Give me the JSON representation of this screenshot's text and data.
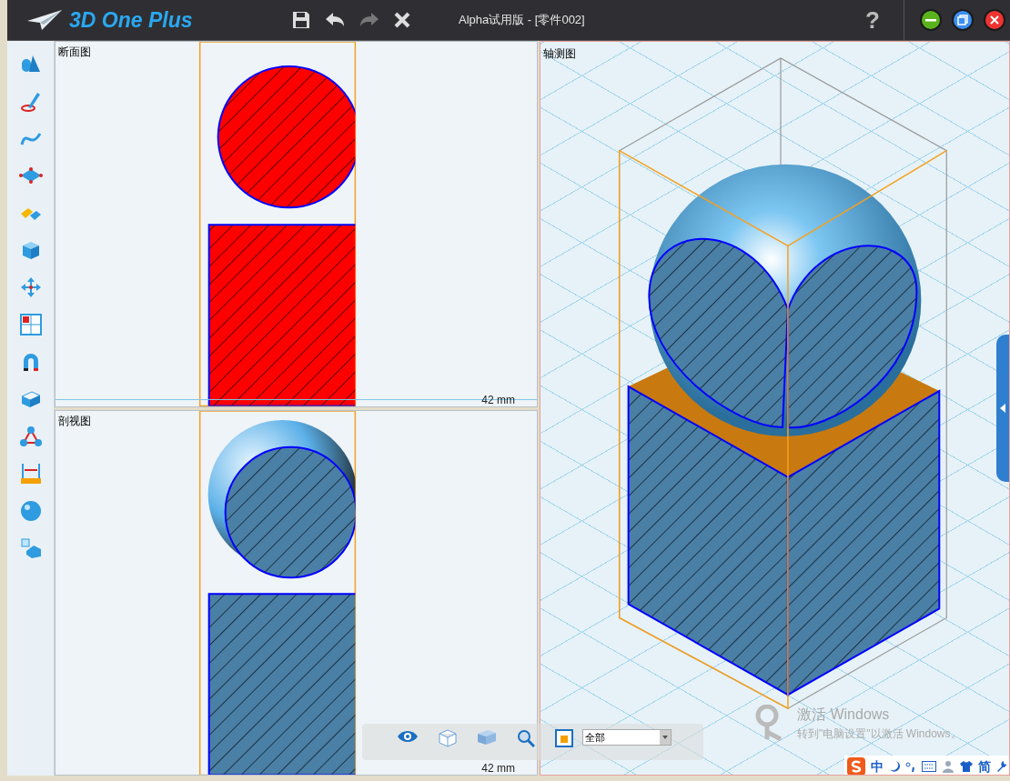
{
  "window": {
    "logo": "3D One Plus",
    "title": "Alpha试用版 - [零件002]",
    "help": "?"
  },
  "views": [
    {
      "title": "断面图",
      "dimension": "42 mm"
    },
    {
      "title": "剖视图",
      "dimension": "42 mm"
    },
    {
      "title": "轴测图"
    }
  ],
  "view_toolbar": {
    "filter": "全部"
  },
  "activation_notice": {
    "title": "激活 Windows",
    "text": "转到\"电脑设置\"以激活 Windows。"
  },
  "ime_bar": {
    "mode": "中",
    "script": "简"
  }
}
